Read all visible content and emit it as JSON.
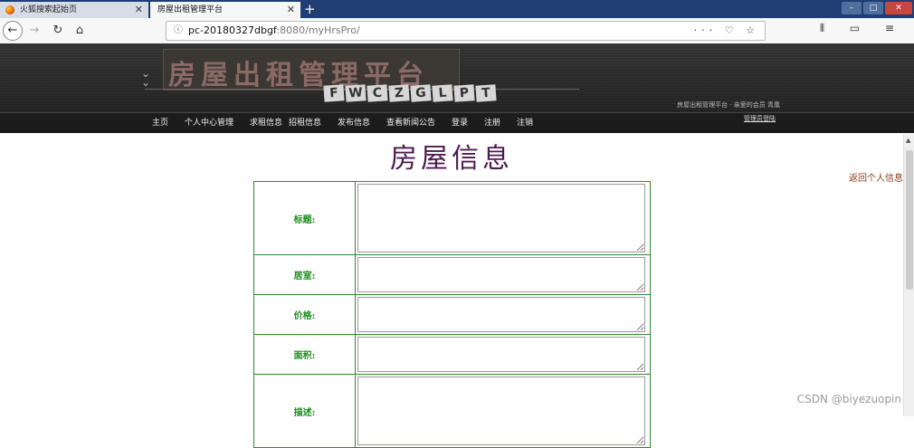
{
  "browser": {
    "tabs": [
      {
        "label": "火狐搜索起始页",
        "close": "✕"
      },
      {
        "label": "房屋出租管理平台",
        "close": "✕"
      }
    ],
    "new_tab": "+",
    "back": "←",
    "forward": "→",
    "reload": "↻",
    "home": "⌂",
    "url_info": "ⓘ",
    "url_host": "pc-20180327dbgf",
    "url_rest": ":8080/myHrsPro/",
    "url_actions": "··· ♡ ☆",
    "toolbar_icons": "⫴ ▭ ≡",
    "window_controls": {
      "minimize": "–",
      "maximize": "□",
      "close": "✕"
    }
  },
  "site": {
    "logo_title": "房屋出租管理平台",
    "logo_letters": [
      "F",
      "W",
      "C",
      "Z",
      "G",
      "L",
      "P",
      "T"
    ],
    "header_info": "房屋出租管理平台 · 亲爱的会员 青凰",
    "menu": [
      "主页",
      "个人中心管理",
      "求租信息",
      "招租信息",
      "发布信息",
      "查看新闻公告",
      "登录",
      "注册",
      "注销"
    ],
    "admin_link": "管理员登陆"
  },
  "page": {
    "title": "房屋信息",
    "back_link": "返回个人信息",
    "fields": [
      {
        "label": "标题:",
        "value": ""
      },
      {
        "label": "居室:",
        "value": ""
      },
      {
        "label": "价格:",
        "value": ""
      },
      {
        "label": "面积:",
        "value": ""
      },
      {
        "label": "描述:",
        "value": ""
      }
    ]
  },
  "watermark": "CSDN @biyezuopin"
}
